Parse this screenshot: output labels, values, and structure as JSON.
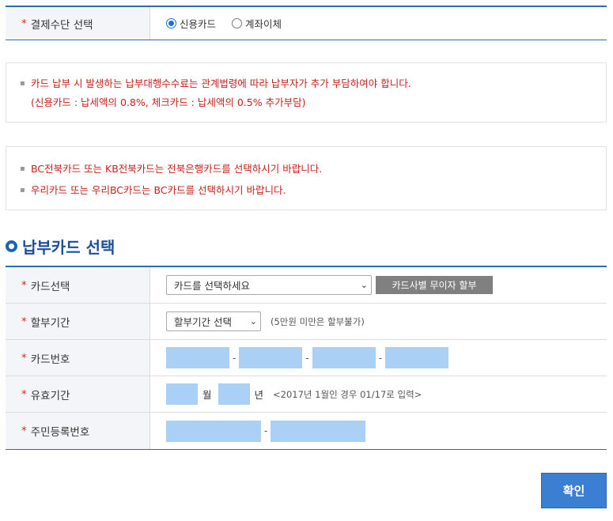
{
  "payment_method": {
    "label": "결제수단 선택",
    "required_mark": "*",
    "options": [
      {
        "label": "신용카드",
        "checked": true
      },
      {
        "label": "계좌이체",
        "checked": false
      }
    ]
  },
  "notice1": {
    "bullet": "▪",
    "line1": "카드 납부 시 발생하는 납부대행수수료는 관계법령에 따라 납부자가 추가 부담하여야 합니다.",
    "line2": "(신용카드 : 납세액의 0.8%, 체크카드 : 납세액의 0.5% 추가부담)"
  },
  "notice2": {
    "bullet": "▪",
    "line1": "BC전북카드 또는 KB전북카드는 전북은행카드를 선택하시기 바랍니다.",
    "line2": "우리카드 또는 우리BC카드는 BC카드를 선택하시기 바랍니다."
  },
  "section": {
    "title": "납부카드 선택"
  },
  "card_form": {
    "required_mark": "*",
    "card_select": {
      "label": "카드선택",
      "value": "카드를 선택하세요",
      "button": "카드사별 무이자 할부"
    },
    "installment": {
      "label": "할부기간",
      "value": "할부기간 선택",
      "hint": "(5만원 미만은 할부불가)"
    },
    "card_number": {
      "label": "카드번호",
      "sep": "-"
    },
    "expiry": {
      "label": "유효기간",
      "month_unit": "월",
      "year_unit": "년",
      "hint": "<2017년 1월인 경우 01/17로 입력>"
    },
    "resident_number": {
      "label": "주민등록번호",
      "sep": "-"
    }
  },
  "confirm_button": "확인",
  "colors": {
    "accent": "#2a6cb5",
    "notice_text": "#c8201a",
    "input_fill": "#aad0f5",
    "button": "#3a7fd1"
  }
}
